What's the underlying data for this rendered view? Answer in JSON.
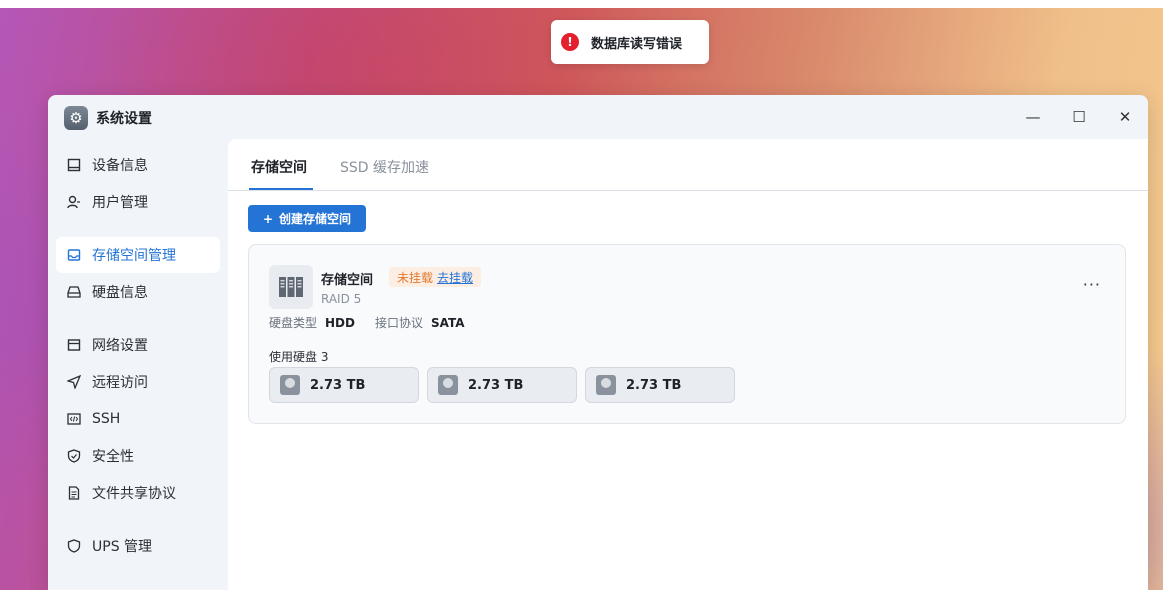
{
  "toast": {
    "message": "数据库读写错误",
    "icon": "error-icon"
  },
  "window": {
    "title": "系统设置",
    "controls": {
      "minimize": "—",
      "maximize": "☐",
      "close": "✕"
    }
  },
  "sidebar": {
    "items": [
      {
        "label": "设备信息",
        "icon": "device-icon"
      },
      {
        "label": "用户管理",
        "icon": "user-icon"
      },
      {
        "label": "存储空间管理",
        "icon": "storage-icon",
        "active": true
      },
      {
        "label": "硬盘信息",
        "icon": "disk-icon"
      },
      {
        "label": "网络设置",
        "icon": "network-icon"
      },
      {
        "label": "远程访问",
        "icon": "send-icon"
      },
      {
        "label": "SSH",
        "icon": "code-icon"
      },
      {
        "label": "安全性",
        "icon": "shield-check-icon"
      },
      {
        "label": "文件共享协议",
        "icon": "file-icon"
      },
      {
        "label": "UPS 管理",
        "icon": "shield-icon"
      }
    ]
  },
  "tabs": [
    {
      "label": "存储空间",
      "active": true
    },
    {
      "label": "SSD 缓存加速",
      "active": false
    }
  ],
  "create_button": {
    "icon": "+",
    "label": "创建存储空间"
  },
  "volume": {
    "name": "存储空间",
    "status": "未挂载",
    "mount_link": "去挂载",
    "raid": "RAID 5",
    "disk_type_label": "硬盘类型",
    "disk_type": "HDD",
    "interface_label": "接口协议",
    "interface": "SATA",
    "used_disks_label": "使用硬盘 3",
    "more": "···",
    "disks": [
      {
        "size": "2.73 TB"
      },
      {
        "size": "2.73 TB"
      },
      {
        "size": "2.73 TB"
      }
    ]
  },
  "colors": {
    "accent": "#2474d6",
    "error": "#e5202e",
    "warning": "#e07a2e"
  }
}
